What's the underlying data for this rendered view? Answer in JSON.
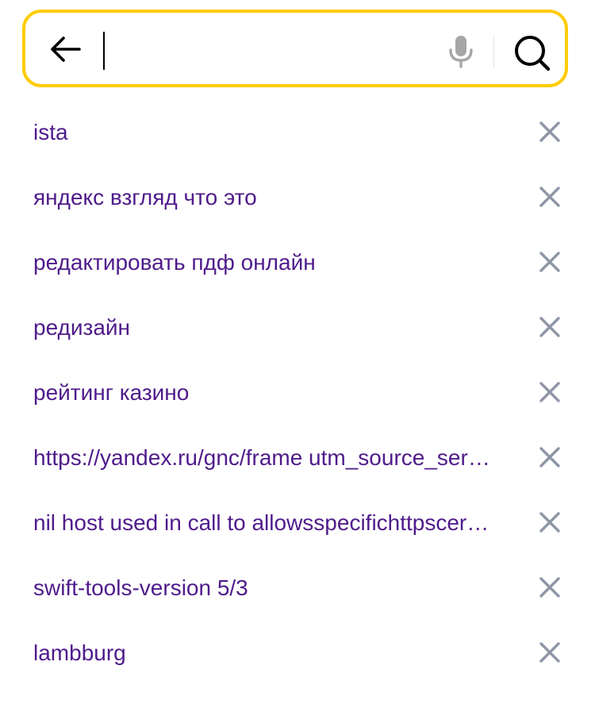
{
  "search": {
    "value": "",
    "placeholder": "",
    "border_color": "#ffcc00"
  },
  "icons": {
    "back": "arrow-left-icon",
    "mic": "microphone-icon",
    "search": "magnifier-icon",
    "remove": "close-icon"
  },
  "colors": {
    "suggestion_text": "#4f1b8b",
    "remove_icon": "#8e96a6",
    "mic_icon": "#a6a6a6"
  },
  "suggestions": [
    {
      "text": "ista"
    },
    {
      "text": "яндекс взгляд что это"
    },
    {
      "text": "редактировать пдф онлайн"
    },
    {
      "text": "редизайн"
    },
    {
      "text": "рейтинг казино"
    },
    {
      "text": "https://yandex.ru/gnc/frame utm_source_ser…"
    },
    {
      "text": "nil host used in call to allowsspecifichttpscer…"
    },
    {
      "text": "swift-tools-version 5/3"
    },
    {
      "text": "lambburg"
    }
  ]
}
